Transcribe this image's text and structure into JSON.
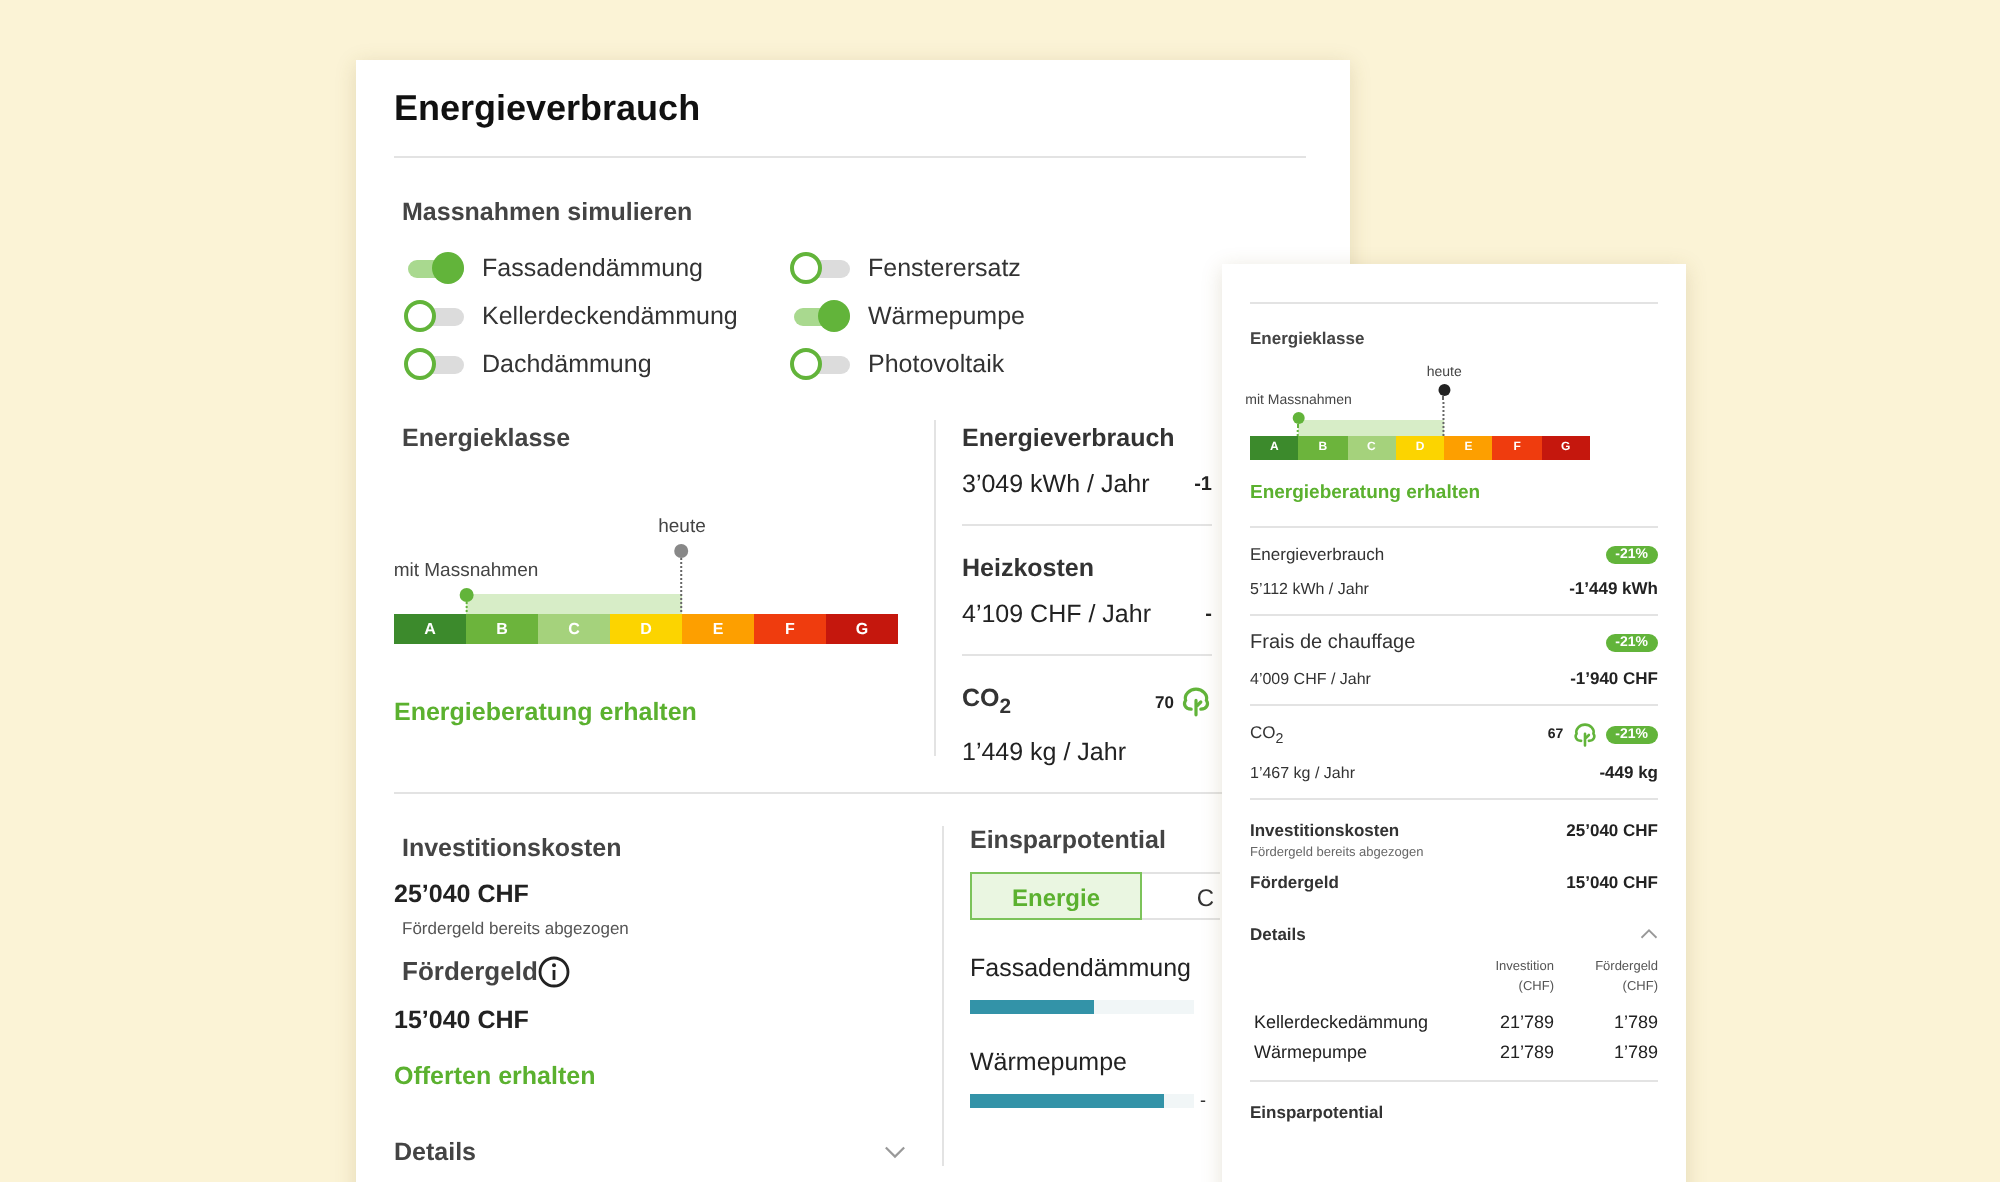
{
  "main_card": {
    "title": "Energieverbrauch",
    "measures": {
      "heading": "Massnahmen simulieren",
      "items": [
        {
          "label": "Fassadendämmung",
          "on": true
        },
        {
          "label": "Fensterersatz",
          "on": false
        },
        {
          "label": "Kellerdeckendämmung",
          "on": false
        },
        {
          "label": "Wärmepumpe",
          "on": true
        },
        {
          "label": "Dachdämmung",
          "on": false
        },
        {
          "label": "Photovoltaik",
          "on": false
        }
      ]
    },
    "energy_class": {
      "heading": "Energieklasse",
      "classes": [
        {
          "label": "A",
          "color": "#3c8a2c"
        },
        {
          "label": "B",
          "color": "#6cb43c",
          "marker": {
            "label": "mit Massnahmen",
            "kind": "target"
          }
        },
        {
          "label": "C",
          "color": "#a5d27c"
        },
        {
          "label": "D",
          "color": "#fcd400"
        },
        {
          "label": "E",
          "color": "#fd9f00",
          "marker": {
            "label": "heute",
            "kind": "current"
          }
        },
        {
          "label": "F",
          "color": "#ef3c0e"
        },
        {
          "label": "G",
          "color": "#c5170d"
        }
      ],
      "link": "Energieberatung erhalten"
    },
    "metrics": [
      {
        "label": "Energieverbrauch",
        "value": "3’049 kWh / Jahr",
        "delta": "-1"
      },
      {
        "label": "Heizkosten",
        "value": "4’109 CHF / Jahr",
        "delta": "-"
      },
      {
        "label": "CO$_{2}$",
        "value": "1’449 kg / Jahr",
        "trees": "70"
      }
    ],
    "investment": {
      "heading": "Investitionskosten",
      "amount": "25’040 CHF",
      "note": "Fördergeld bereits abgezogen",
      "subsidy_label": "Fördergeld",
      "subsidy": "15’040 CHF",
      "link": "Offerten erhalten",
      "details": {
        "label": "Details",
        "expanded": false
      }
    },
    "savings": {
      "heading": "Einsparpotential",
      "tabs": [
        {
          "label": "Energie",
          "selected": true
        },
        {
          "label": "C",
          "selected": false
        }
      ],
      "items": [
        {
          "label": "Fassadendämmung",
          "level": 0.55
        },
        {
          "label": "Wärmepumpe",
          "level": 0.87,
          "delta": "-"
        }
      ]
    }
  },
  "mobile_card": {
    "energy_class": {
      "heading": "Energieklasse",
      "classes": [
        {
          "label": "A",
          "color": "#3c8a2c"
        },
        {
          "label": "B",
          "color": "#6cb43c",
          "marker": {
            "label": "mit Massnahmen",
            "kind": "target"
          }
        },
        {
          "label": "C",
          "color": "#a5d27c"
        },
        {
          "label": "D",
          "color": "#fcd400"
        },
        {
          "label": "E",
          "color": "#fd9f00",
          "marker": {
            "label": "heute",
            "kind": "current"
          }
        },
        {
          "label": "F",
          "color": "#ef3c0e"
        },
        {
          "label": "G",
          "color": "#c5170d"
        }
      ],
      "link": "Energieberatung erhalten"
    },
    "metrics": [
      {
        "label": "Energieverbrauch",
        "badge": "-21%",
        "value": "5’112 kWh / Jahr",
        "delta": "-1’449 kWh"
      },
      {
        "label": "Frais de chauffage",
        "badge": "-21%",
        "value": "4’009 CHF / Jahr",
        "delta": "-1’940 CHF"
      },
      {
        "label": "CO$_{2}$",
        "trees": "67",
        "badge": "-21%",
        "value": "1’467 kg / Jahr",
        "delta": "-449 kg"
      }
    ],
    "investment": {
      "label": "Investitionskosten",
      "amount": "25’040 CHF",
      "note": "Fördergeld bereits abgezogen",
      "subsidy_label": "Fördergeld",
      "subsidy": "15’040 CHF"
    },
    "details": {
      "label": "Details",
      "expanded": true,
      "columns": [
        "",
        "Investition (CHF)",
        "Fördergeld (CHF)"
      ],
      "rows": [
        [
          "Kellerdeckedämmung",
          "21’789",
          "1’789"
        ],
        [
          "Wärmepumpe",
          "21’789",
          "1’789"
        ]
      ]
    },
    "savings_heading": "Einsparpotential"
  }
}
